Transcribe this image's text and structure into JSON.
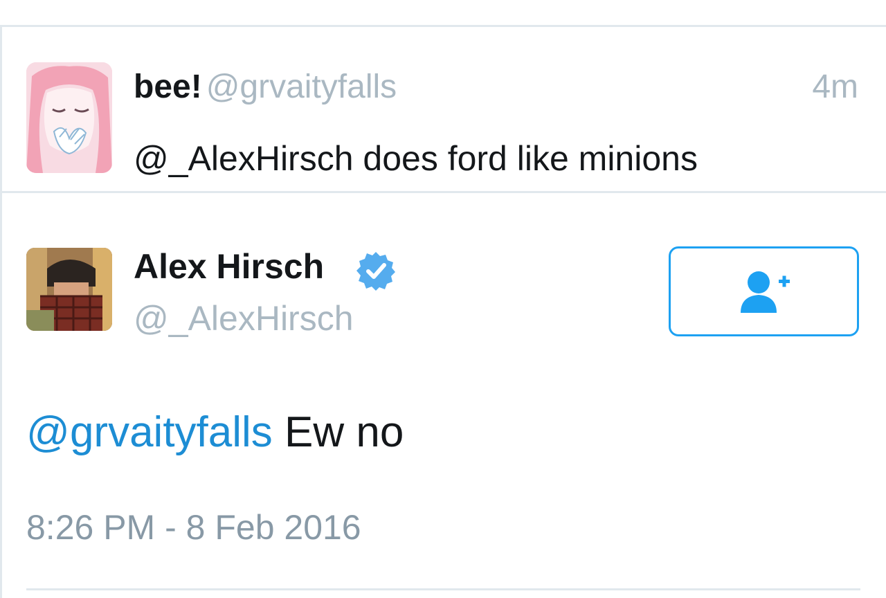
{
  "parent_tweet": {
    "name": "bee!",
    "handle": "@grvaityfalls",
    "time": "4m",
    "text": "@_AlexHirsch does ford like minions"
  },
  "main_tweet": {
    "name": "Alex Hirsch",
    "handle": "@_AlexHirsch",
    "verified": true,
    "follow_icon": "add-user-icon",
    "mention": "@grvaityfalls",
    "text": " Ew no",
    "timestamp": "8:26 PM - 8 Feb 2016"
  },
  "colors": {
    "accent": "#1da1f2",
    "mention": "#1d8dd4",
    "muted": "#aab8c2",
    "text": "#14171a",
    "divider": "#e1e8ed"
  }
}
